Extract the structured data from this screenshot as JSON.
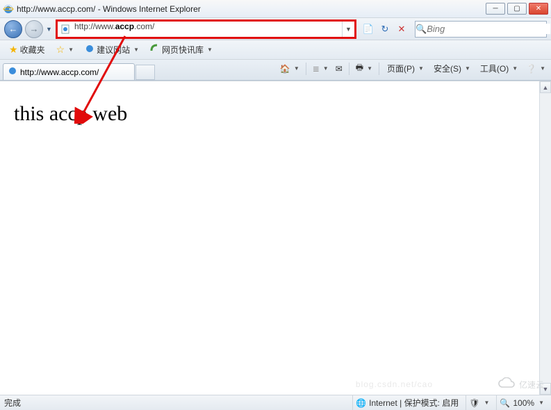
{
  "window": {
    "title": "http://www.accp.com/ - Windows Internet Explorer"
  },
  "address": {
    "url_prefix": "http://www.",
    "url_bold": "accp",
    "url_suffix": ".com/"
  },
  "search": {
    "placeholder": "Bing"
  },
  "favorites": {
    "label": "收藏夹",
    "suggest": "建议网站",
    "slice": "网页快讯库"
  },
  "tabs": {
    "active": "http://www.accp.com/"
  },
  "commands": {
    "page": "页面(P)",
    "safety": "安全(S)",
    "tools": "工具(O)"
  },
  "page": {
    "body_text": "this accp web"
  },
  "status": {
    "done": "完成",
    "zone": "Internet | 保护模式: 启用",
    "zoom": "100%"
  },
  "watermark": {
    "blog": "blog.csdn.net/cao",
    "brand": "亿速云"
  }
}
